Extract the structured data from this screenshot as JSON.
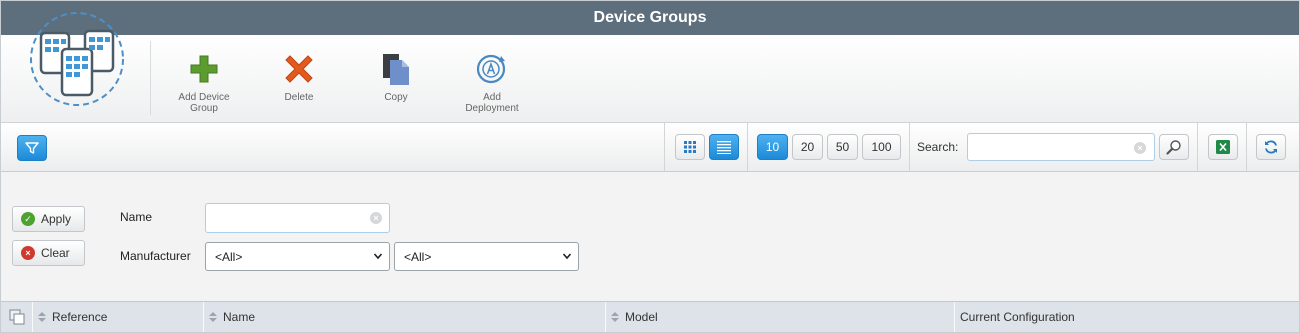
{
  "window": {
    "title": "Device Groups"
  },
  "ribbon": {
    "logo_icon": "device-group-logo-icon",
    "actions": [
      {
        "label_line1": "Add Device",
        "label_line2": "Group",
        "icon": "add-plus-icon",
        "color": "#5a9a2e"
      },
      {
        "label_line1": "Delete",
        "label_line2": "",
        "icon": "delete-x-icon",
        "color": "#e2581f"
      },
      {
        "label_line1": "Copy",
        "label_line2": "",
        "icon": "copy-icon",
        "color": "#6f8fc9"
      },
      {
        "label_line1": "Add",
        "label_line2": "Deployment",
        "icon": "deployment-icon",
        "color": "#4a88c2"
      }
    ]
  },
  "toolbar": {
    "filter_icon": "filter-icon",
    "grid_view_icon": "grid-view-icon",
    "list_view_icon": "list-view-icon",
    "page_sizes": [
      "10",
      "20",
      "50",
      "100"
    ],
    "selected_page_size": "10",
    "search_label": "Search:",
    "search_value": "",
    "search_icon": "magnifier-icon",
    "excel_icon": "excel-export-icon",
    "refresh_icon": "refresh-icon"
  },
  "filters": {
    "apply_label": "Apply",
    "clear_label": "Clear",
    "name_label": "Name",
    "name_value": "",
    "manufacturer_label": "Manufacturer",
    "manufacturer_value": "<All>",
    "model_value": "<All>"
  },
  "table": {
    "columns": [
      "Reference",
      "Name",
      "Model",
      "Current Configuration"
    ]
  },
  "colors": {
    "titlebar": "#5d6f7c",
    "accent_blue": "#1c8ad8",
    "header_bg": "#dde3e8"
  }
}
